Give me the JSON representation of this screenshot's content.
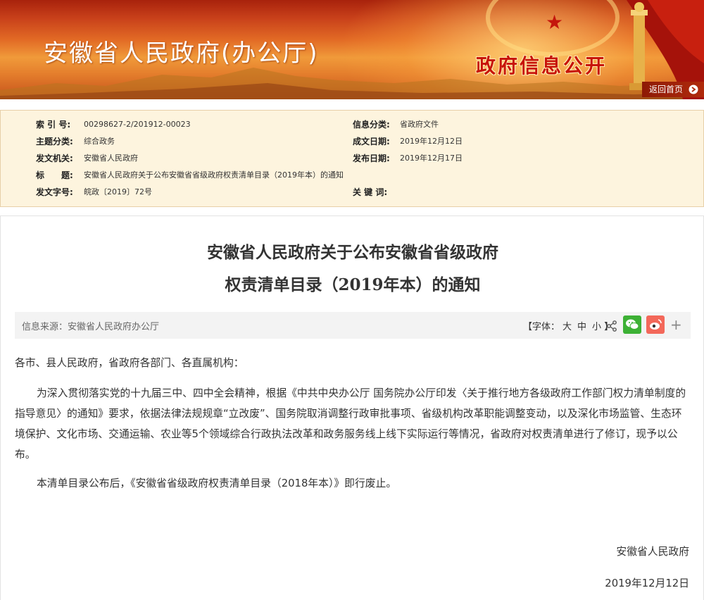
{
  "banner": {
    "site_title": "安徽省人民政府(办公厅)",
    "section_title": "政府信息公开",
    "home_link": "返回首页"
  },
  "meta": {
    "index_no_label": "索 引 号:",
    "index_no": "00298627-2/201912-00023",
    "info_class_label": "信息分类:",
    "info_class": "省政府文件",
    "topic_label": "主题分类:",
    "topic": "综合政务",
    "made_date_label": "成文日期:",
    "made_date": "2019年12月12日",
    "issuer_label": "发文机关:",
    "issuer": "安徽省人民政府",
    "publish_date_label": "发布日期:",
    "publish_date": "2019年12月17日",
    "title_label": "标　　题:",
    "title": "安徽省人民政府关于公布安徽省省级政府权责清单目录（2019年本）的通知",
    "doc_no_label": "发文字号:",
    "doc_no": "皖政〔2019〕72号",
    "keywords_label": "关 键 词:",
    "keywords": ""
  },
  "article": {
    "title_line1": "安徽省人民政府关于公布安徽省省级政府",
    "title_line2": "权责清单目录（2019年本）的通知",
    "source": "信息来源：安徽省人民政府办公厅",
    "font_prefix": "【字体：",
    "font_large": "大",
    "font_medium": "中",
    "font_small": "小",
    "font_suffix": "】",
    "paragraphs": [
      "各市、县人民政府，省政府各部门、各直属机构：",
      "为深入贯彻落实党的十九届三中、四中全会精神，根据《中共中央办公厅 国务院办公厅印发〈关于推行地方各级政府工作部门权力清单制度的指导意见〉的通知》要求，依据法律法规规章“立改废”、国务院取消调整行政审批事项、省级机构改革职能调整变动，以及深化市场监管、生态环境保护、文化市场、交通运输、农业等5个领域综合行政执法改革和政务服务线上线下实际运行等情况，省政府对权责清单进行了修订，现予以公布。",
      "本清单目录公布后，《安徽省省级政府权责清单目录（2018年本）》即行废止。"
    ],
    "signature": "安徽省人民政府",
    "date": "2019年12月12日"
  },
  "icons": {
    "share": "share-icon",
    "wechat": "wechat-icon",
    "weibo": "weibo-icon",
    "more": "plus-icon"
  },
  "colors": {
    "banner_red": "#c8401a",
    "title_red": "#c8140a",
    "meta_bg": "#fdf4de",
    "wechat_green": "#3db135",
    "weibo_red": "#f3685a"
  }
}
